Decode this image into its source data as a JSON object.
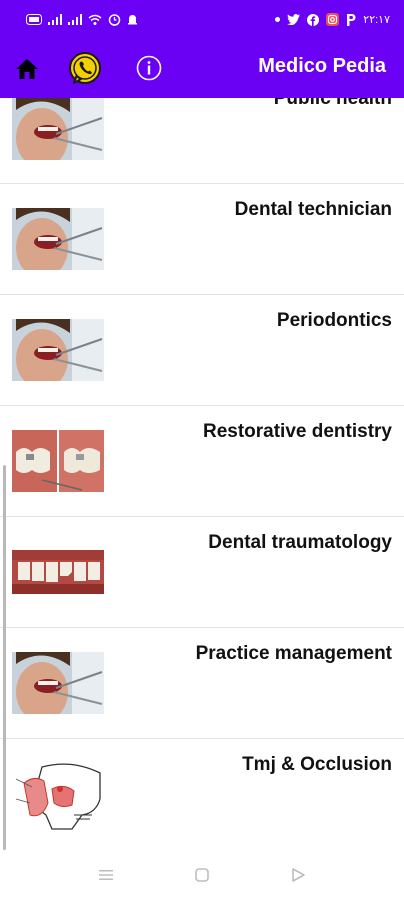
{
  "status_bar": {
    "left_icons": [
      "sim-icon",
      "signal-icon",
      "signal-icon",
      "wifi-icon",
      "alarm-icon",
      "notification-icon"
    ],
    "right_icons": [
      "dot-icon",
      "twitter-icon",
      "facebook-icon",
      "instagram-icon",
      "p-icon"
    ],
    "time": "۲۲:۱۷"
  },
  "app_bar": {
    "title": "Medico Pedia",
    "background": "#6a00f4",
    "icons": [
      "home-icon",
      "whatsapp-icon",
      "info-icon"
    ]
  },
  "list": {
    "items": [
      {
        "title": "Public health",
        "image": "dental-exam-photo"
      },
      {
        "title": "Dental technician",
        "image": "dental-exam-photo"
      },
      {
        "title": "Periodontics",
        "image": "dental-exam-photo"
      },
      {
        "title": "Restorative dentistry",
        "image": "restorative-teeth-photo"
      },
      {
        "title": "Dental traumatology",
        "image": "broken-tooth-photo"
      },
      {
        "title": "Practice management",
        "image": "dental-exam-photo"
      },
      {
        "title": "Tmj & Occlusion",
        "image": "tmj-skull-illustration"
      }
    ]
  },
  "nav_bar": {
    "icons": [
      "menu-icon",
      "home-square-icon",
      "back-triangle-icon"
    ]
  }
}
